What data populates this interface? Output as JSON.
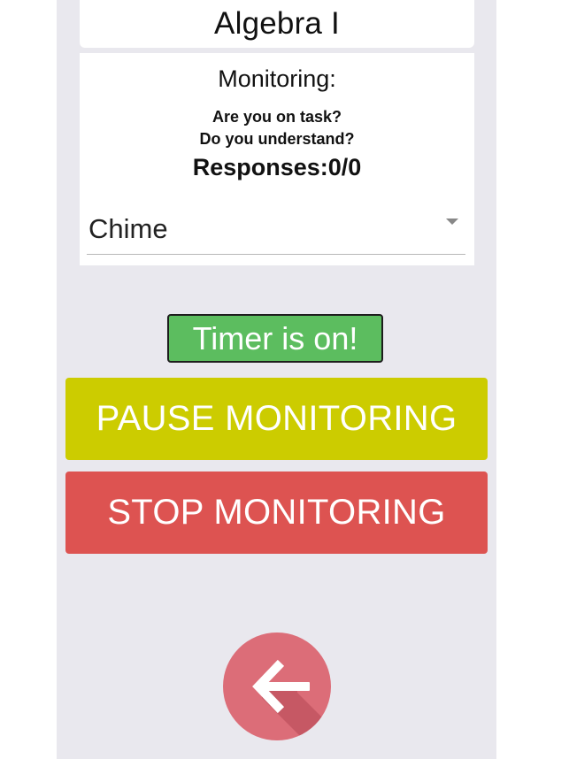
{
  "header": {
    "class_title": "Algebra I"
  },
  "monitor_card": {
    "label": "Monitoring:",
    "prompt_line1": "Are you on task?",
    "prompt_line2": "Do you understand?",
    "responses_text": "Responses:0/0",
    "sound_select": {
      "selected": "Chime",
      "icon": "chevron-down-icon"
    }
  },
  "timer_badge": {
    "label": "Timer is on!",
    "color": "#5cbd5f"
  },
  "buttons": {
    "pause_label": "PAUSE MONITORING",
    "pause_color": "#cccc00",
    "stop_label": "STOP MONITORING",
    "stop_color": "#dd5351",
    "back_icon": "arrow-left-icon",
    "back_color": "#dc6d78"
  }
}
